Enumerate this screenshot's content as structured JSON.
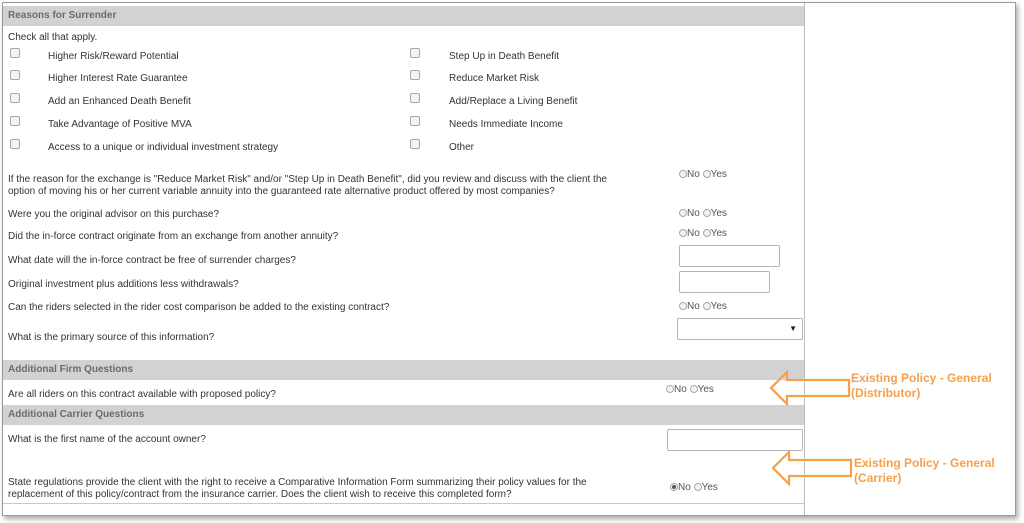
{
  "surrender": {
    "header": "Reasons for Surrender",
    "instruction": "Check all that apply.",
    "left_options": [
      "Higher Risk/Reward Potential",
      "Higher Interest Rate Guarantee",
      "Add an Enhanced Death Benefit",
      "Take Advantage of Positive MVA",
      "Access to a unique or individual investment strategy"
    ],
    "right_options": [
      "Step Up in Death Benefit",
      "Reduce Market Risk",
      "Add/Replace a Living Benefit",
      "Needs Immediate Income",
      "Other"
    ]
  },
  "questions": {
    "reduce_risk_line1": "If the reason for the exchange is \"Reduce Market Risk\" and/or \"Step Up in Death Benefit\", did you review and discuss with the client the",
    "reduce_risk_line2": "option of moving his or her current variable annuity into the guaranteed rate alternative product offered by most companies?",
    "original_advisor": "Were you the original advisor on this purchase?",
    "in_force_exchange": "Did the in-force contract originate from an exchange from another annuity?",
    "free_of_charges": "What date will the in-force contract be free of surrender charges?",
    "original_investment": "Original investment plus additions less withdrawals?",
    "riders_added": "Can the riders selected in the rider cost comparison be added to the existing contract?",
    "primary_source": "What is the primary source of this information?"
  },
  "radio_labels": {
    "no": "No",
    "yes": "Yes"
  },
  "firm": {
    "header": "Additional Firm Questions",
    "riders_available": "Are all riders on this contract available with proposed policy?"
  },
  "carrier": {
    "header": "Additional Carrier Questions",
    "first_name": "What is the first name of the account owner?",
    "state_reg_line1": "State regulations provide the client with the right to receive a Comparative Information Form summarizing their policy values for the",
    "state_reg_line2": "replacement of this policy/contract from the insurance carrier. Does the client wish to receive this completed form?",
    "state_reg_selected": "No"
  },
  "callouts": {
    "distributor_line1": "Existing Policy - General",
    "distributor_line2": "(Distributor)",
    "carrier_line1": "Existing Policy - General",
    "carrier_line2": "(Carrier)"
  },
  "colors": {
    "header_bg": "#d2d2d2",
    "callout": "#f5a04a"
  }
}
